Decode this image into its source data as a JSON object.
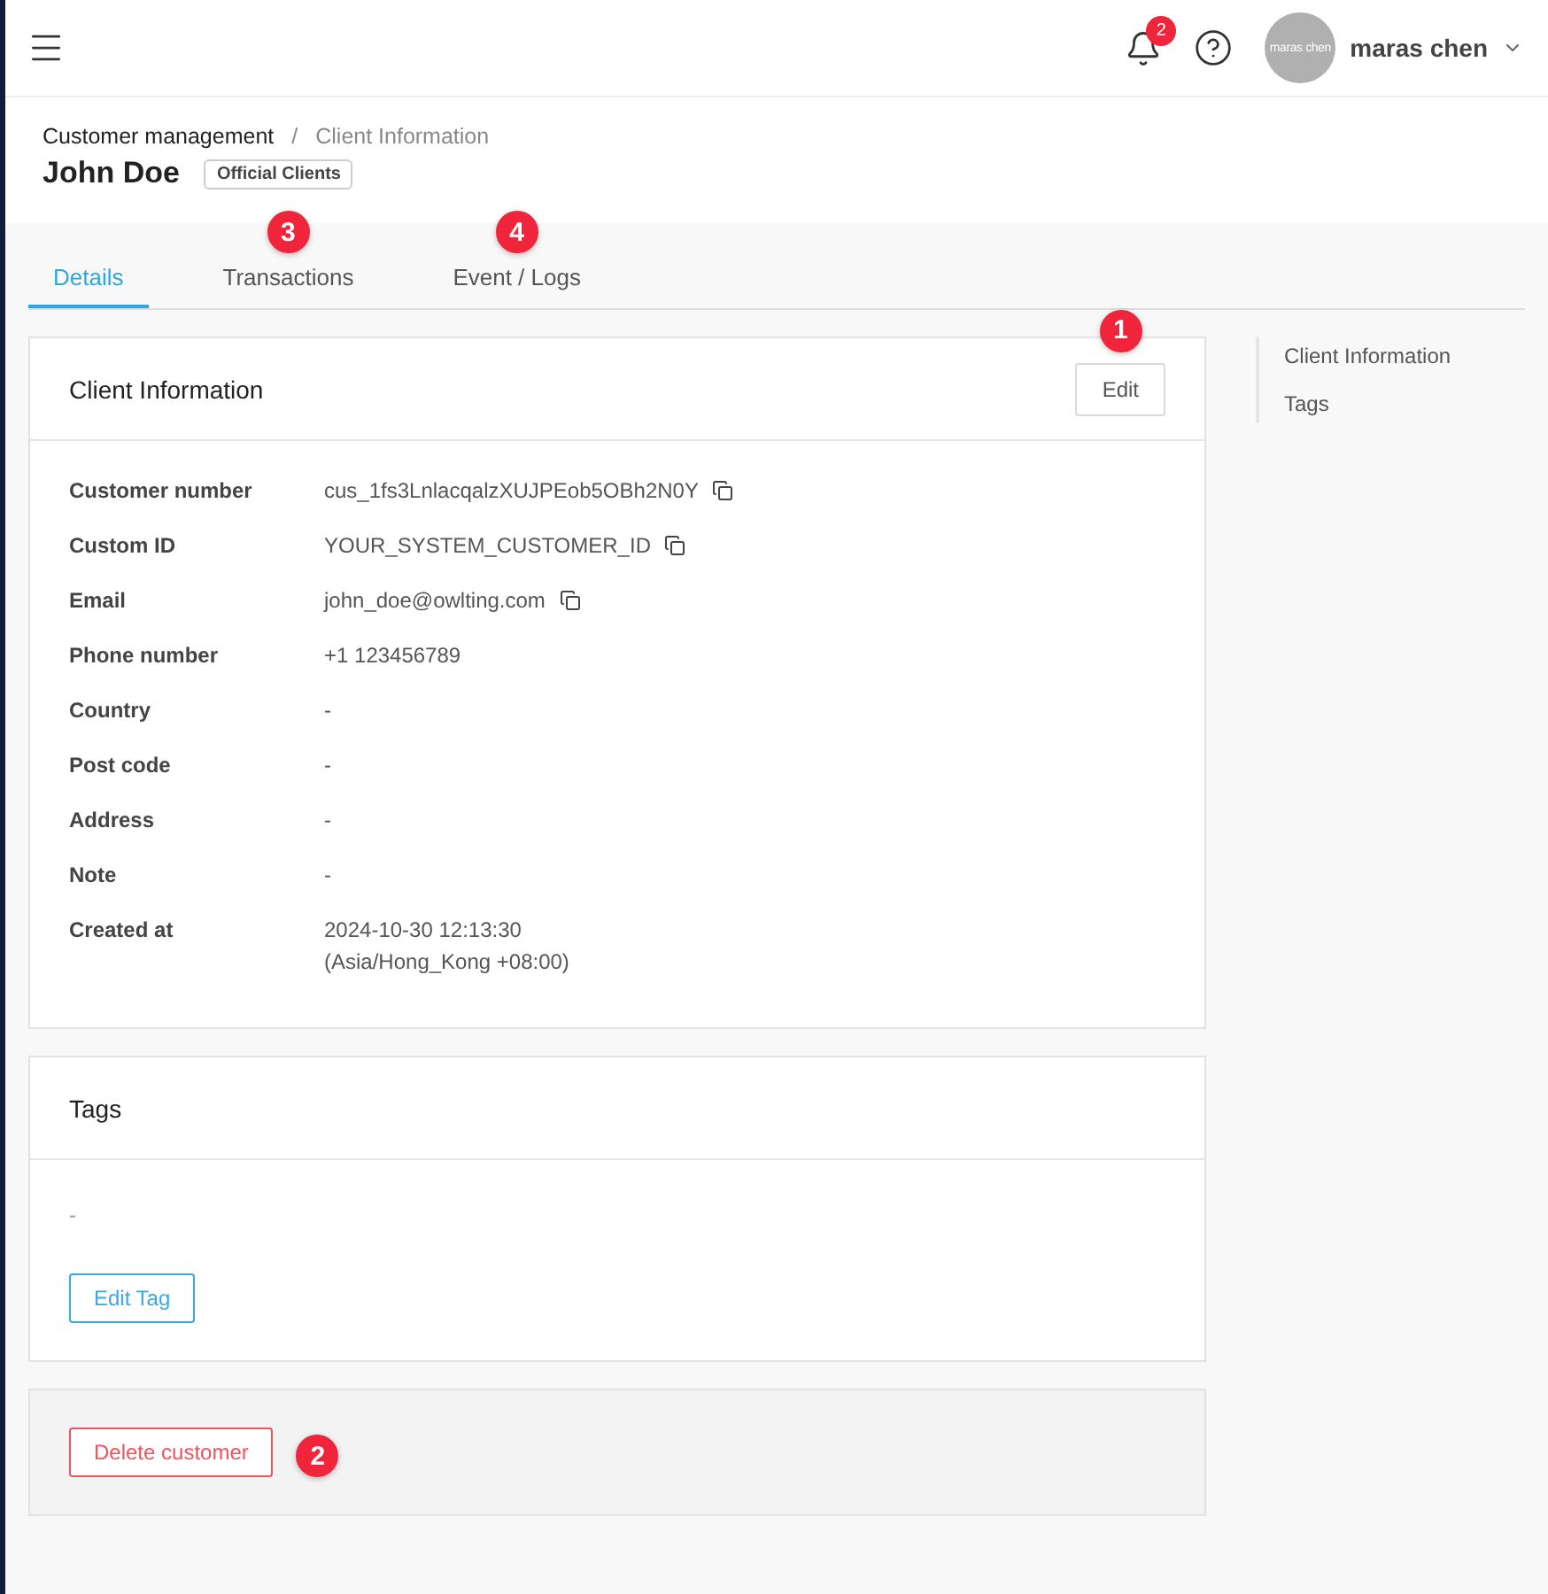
{
  "topbar": {
    "notifications": "2",
    "user": {
      "avatar_text": "maras chen",
      "name": "maras chen"
    }
  },
  "breadcrumb": [
    "Customer management",
    "Client Information"
  ],
  "breadcrumb_separator": "/",
  "title": "John Doe",
  "badge": "Official Clients",
  "tabs": [
    {
      "label": "Details",
      "selected": true
    },
    {
      "label": "Transactions",
      "selected": false,
      "callout": "3"
    },
    {
      "label": "Event / Logs",
      "selected": false,
      "callout": "4"
    }
  ],
  "client_card": {
    "title": "Client Information",
    "edit_button": "Edit",
    "edit_callout": "1",
    "fields": [
      {
        "label": "Customer number",
        "value": "cus_1fs3LnlacqalzXUJPEob5OBh2N0Y",
        "copyable": true
      },
      {
        "label": "Custom ID",
        "value": "YOUR_SYSTEM_CUSTOMER_ID",
        "copyable": true
      },
      {
        "label": "Email",
        "value": "john_doe@owlting.com",
        "copyable": true
      },
      {
        "label": "Phone number",
        "value": "+1 123456789",
        "copyable": false
      },
      {
        "label": "Country",
        "value": "-",
        "copyable": false
      },
      {
        "label": "Post code",
        "value": "-",
        "copyable": false
      },
      {
        "label": "Address",
        "value": "-",
        "copyable": false
      },
      {
        "label": "Note",
        "value": "-",
        "copyable": false
      },
      {
        "label": "Created at",
        "value": "2024-10-30 12:13:30",
        "value_2": "(Asia/Hong_Kong +08:00)",
        "copyable": false
      }
    ]
  },
  "tags_card": {
    "title": "Tags",
    "value": "-",
    "button": "Edit Tag"
  },
  "danger": {
    "button": "Delete customer",
    "callout": "2"
  },
  "side_nav": [
    "Client Information",
    "Tags"
  ]
}
